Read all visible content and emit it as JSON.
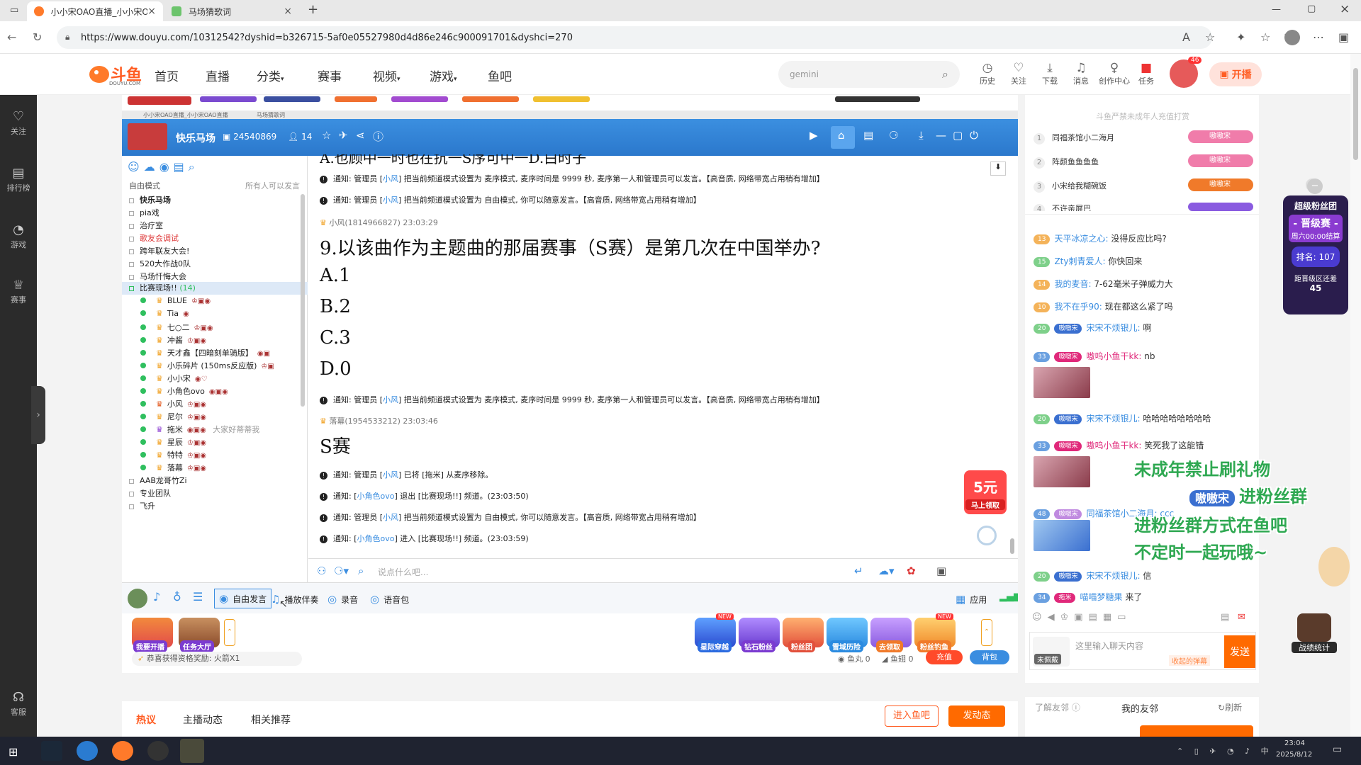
{
  "browser": {
    "tabs": [
      {
        "title": "小小宋OAO直播_小小宋OAO直播",
        "active": true
      },
      {
        "title": "马场猜歌词",
        "active": false
      }
    ],
    "url": "https://www.douyu.com/10312542?dyshid=b326715-5af0e05527980d4d86e246c900091701&dyshci=270"
  },
  "header": {
    "logo_text": "斗鱼",
    "logo_sub": "DOUYU.COM",
    "nav": [
      "首页",
      "直播",
      "分类",
      "赛事",
      "视频",
      "游戏",
      "鱼吧"
    ],
    "search_placeholder": "gemini",
    "icons": [
      {
        "label": "历史",
        "icon": "clock-icon"
      },
      {
        "label": "关注",
        "icon": "heart-icon"
      },
      {
        "label": "下载",
        "icon": "download-icon"
      },
      {
        "label": "消息",
        "icon": "bell-icon"
      },
      {
        "label": "创作中心",
        "icon": "bulb-icon"
      },
      {
        "label": "任务",
        "icon": "gift-icon"
      }
    ],
    "avatar_badge": "46",
    "start_live": "开播"
  },
  "leftbar": [
    {
      "label": "关注",
      "icon": "heart-icon"
    },
    {
      "label": "排行榜",
      "icon": "rank-icon"
    },
    {
      "label": "游戏",
      "icon": "gamepad-icon"
    },
    {
      "label": "赛事",
      "icon": "trophy-icon"
    },
    {
      "label": "客服",
      "icon": "headset-icon"
    }
  ],
  "yy": {
    "inner_tabs": [
      "小小宋OAO直播_小小宋OAO直播",
      "马场猜歌词"
    ],
    "channel_name": "快乐马场",
    "room_id": "24540869",
    "online": "14",
    "mode_label": "自由模式",
    "mode_right": "所有人可以发言",
    "channels": [
      {
        "name": "快乐马场",
        "bold": true
      },
      {
        "name": "pia戏"
      },
      {
        "name": "治疗室"
      },
      {
        "name": "歌友会调试",
        "red": true
      },
      {
        "name": "跨年联友大会!"
      },
      {
        "name": "520大作战0队"
      },
      {
        "name": "马场忏悔大会"
      },
      {
        "name": "比赛现场!!",
        "count": "(14)",
        "expanded": true
      }
    ],
    "members": [
      {
        "name": "BLUE"
      },
      {
        "name": "Tia"
      },
      {
        "name": "七○二"
      },
      {
        "name": "冲酱"
      },
      {
        "name": "天才鑫【四暗刻单骑版】"
      },
      {
        "name": "小乐碎片 (150ms反应版)"
      },
      {
        "name": "小小宋"
      },
      {
        "name": "小角色ovo"
      },
      {
        "name": "小风"
      },
      {
        "name": "尼尔"
      },
      {
        "name": "拖米",
        "note": "大家好蒂蒂我"
      },
      {
        "name": "星辰"
      },
      {
        "name": "特特"
      },
      {
        "name": "落幕"
      }
    ],
    "more_channels": [
      "AAB龙哥竹Zi",
      "专业团队",
      "飞升"
    ],
    "messages": [
      {
        "type": "sys",
        "pre": "通知: 管理员 [",
        "link": "小风",
        "post": "] 把当前频道模式设置为 麦序模式, 麦序时间是 9999 秒, 麦序第一人和管理员可以发言。【高音质, 网络带宽占用稍有增加】"
      },
      {
        "type": "sys",
        "pre": "通知: 管理员 [",
        "link": "小风",
        "post": "] 把当前频道模式设置为 自由模式, 你可以随意发言。【高音质, 网络带宽占用稍有增加】"
      },
      {
        "type": "who",
        "text": "小风(1814966827)  23:03:29"
      },
      {
        "type": "big",
        "text": "9.以该曲作为主题曲的那届赛事（S赛）是第几次在中国举办?"
      },
      {
        "type": "big",
        "text": "A.1"
      },
      {
        "type": "big",
        "text": "B.2"
      },
      {
        "type": "big",
        "text": "C.3"
      },
      {
        "type": "big",
        "text": "D.0"
      },
      {
        "type": "sys",
        "pre": "通知: 管理员 [",
        "link": "小风",
        "post": "] 把当前频道模式设置为 麦序模式, 麦序时间是 9999 秒, 麦序第一人和管理员可以发言。【高音质, 网络带宽占用稍有增加】"
      },
      {
        "type": "who",
        "text": "落幕(1954533212)  23:03:46"
      },
      {
        "type": "big",
        "text": "S赛"
      },
      {
        "type": "sys",
        "pre": "通知: 管理员 [",
        "link": "小风",
        "post": "] 已将 [拖米] 从麦序移除。"
      },
      {
        "type": "sys",
        "pre": "通知: [",
        "link": "小角色ovo",
        "post": "] 退出 [比赛现场!!] 频道。(23:03:50)"
      },
      {
        "type": "sys",
        "pre": "通知: 管理员 [",
        "link": "小风",
        "post": "] 把当前频道模式设置为 自由模式, 你可以随意发言。【高音质, 网络带宽占用稍有增加】"
      },
      {
        "type": "sys",
        "pre": "通知: [",
        "link": "小角色ovo",
        "post": "] 进入 [比赛现场!!] 频道。(23:03:59)"
      }
    ],
    "input_placeholder": "说点什么吧...",
    "bottom": [
      "自由发言",
      "播放伴奏",
      "录音",
      "语音包"
    ],
    "apps_label": "应用",
    "fuli": {
      "amount": "5元",
      "label": "马上领取"
    }
  },
  "giftbar": {
    "left": [
      {
        "label": "我要开播"
      },
      {
        "label": "任务大厅"
      }
    ],
    "reward": "恭喜获得资格奖励: 火箭X1",
    "gifts": [
      "星际穿越",
      "钻石粉丝",
      "粉丝团",
      "雪域历险",
      "去领取",
      "粉丝钓鱼"
    ],
    "yuwan": "鱼丸 0",
    "yuchi": "鱼翅 0",
    "recharge": "充值",
    "bag": "背包"
  },
  "pagetabs": {
    "tabs": [
      "热议",
      "主播动态",
      "相关推荐"
    ],
    "enter": "进入鱼吧",
    "post": "发动态"
  },
  "right": {
    "notice": "斗鱼严禁未成年人充值打赏",
    "ranks": [
      {
        "n": "1",
        "name": "同福茶馆小二海月"
      },
      {
        "n": "2",
        "name": "阵颜鱼鱼鱼鱼"
      },
      {
        "n": "3",
        "name": "小宋给我糊碗饭"
      },
      {
        "n": "4",
        "name": "不许亲屏巴"
      }
    ],
    "rank_badge": "嗷嗷宋",
    "chats": [
      {
        "lv": "13",
        "name": "天平冰凉之心:",
        "text": "没得反应比吗?"
      },
      {
        "lv": "15",
        "name": "Zty刺青爱人:",
        "text": "你快回来"
      },
      {
        "lv": "14",
        "name": "我的麦音:",
        "text": "7-62毫米子弹威力大"
      },
      {
        "lv": "10",
        "name": "我不在乎90:",
        "text": "现在都这么紧了吗"
      },
      {
        "lv": "20",
        "fan": "嗷嗷宋",
        "name": "宋宋不烦银儿:",
        "text": "啊"
      },
      {
        "lv": "33",
        "fan": "嗷嗷宋",
        "name": "嗷呜小鱼干kk:",
        "text": "nb"
      },
      {
        "lv": "20",
        "fan": "嗷嗷宋",
        "name": "宋宋不烦银儿:",
        "text": "哈哈哈哈哈哈哈哈"
      },
      {
        "lv": "33",
        "fan": "嗷嗷宋",
        "name": "嗷呜小鱼干kk:",
        "text": "笑死我了这能错"
      },
      {
        "lv": "48",
        "fan": "嗷嗷宋",
        "name": "同福茶馆小二海月:",
        "text": "ccc"
      },
      {
        "lv": "20",
        "fan": "嗷嗷宋",
        "name": "宋宋不烦银儿:",
        "text": "信"
      },
      {
        "lv": "34",
        "fan": "拖米",
        "name": "喵喵梦糖果",
        "text": "来了"
      }
    ],
    "overlay": [
      "未成年禁止刷礼物",
      "进粉丝群",
      "进粉丝群方式在鱼吧",
      "不定时一起玩哦~"
    ],
    "overlay_badge": "嗷嗷宋",
    "fans": {
      "title": "超级粉丝团",
      "stage": "晋级赛",
      "time": "周六00:00结算",
      "rank": "排名: 107",
      "gap": "距晋级区还差",
      "gap_value": "45"
    },
    "battle": "战绩统计",
    "chat_placeholder": "这里输入聊天内容",
    "unlock": "未佩戴",
    "barrage_hint": "收起的弹幕",
    "send": "发送",
    "friends": {
      "left": "了解友邻",
      "center": "我的友邻",
      "refresh": "刷新"
    }
  },
  "colors": {
    "douyu_orange": "#ff5d23",
    "yy_blue": "#2b78cc",
    "send_orange": "#ff6a00",
    "overlay_green": "#2ea851"
  },
  "taskbar": {
    "time": "23:04",
    "date": "2025/8/12"
  }
}
